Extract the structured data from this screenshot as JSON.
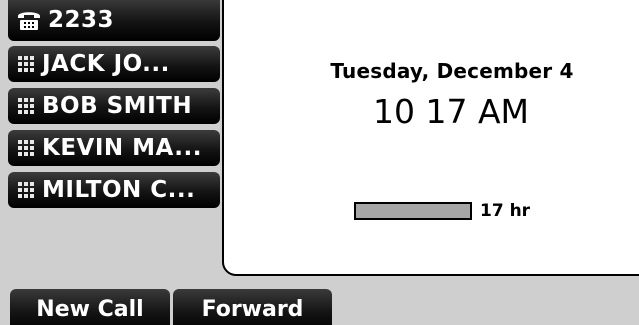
{
  "line_keys": [
    {
      "label": "2233",
      "icon": "phone-icon"
    },
    {
      "label": "JACK JO...",
      "icon": "blf-grid-icon"
    },
    {
      "label": "BOB SMITH",
      "icon": "blf-grid-icon"
    },
    {
      "label": "KEVIN MA...",
      "icon": "blf-grid-icon"
    },
    {
      "label": "MILTON C...",
      "icon": "blf-grid-icon"
    }
  ],
  "idle": {
    "date": "Tuesday, December 4",
    "time": "10 17 AM",
    "uptime_label": "17 hr"
  },
  "softkeys": [
    {
      "label": "New Call"
    },
    {
      "label": "Forward"
    }
  ],
  "colors": {
    "screen_background": "#cfcfcf",
    "panel_background": "#ffffff",
    "key_background": "#000000",
    "key_text": "#ffffff",
    "bar_fill": "#a6a6a6"
  }
}
